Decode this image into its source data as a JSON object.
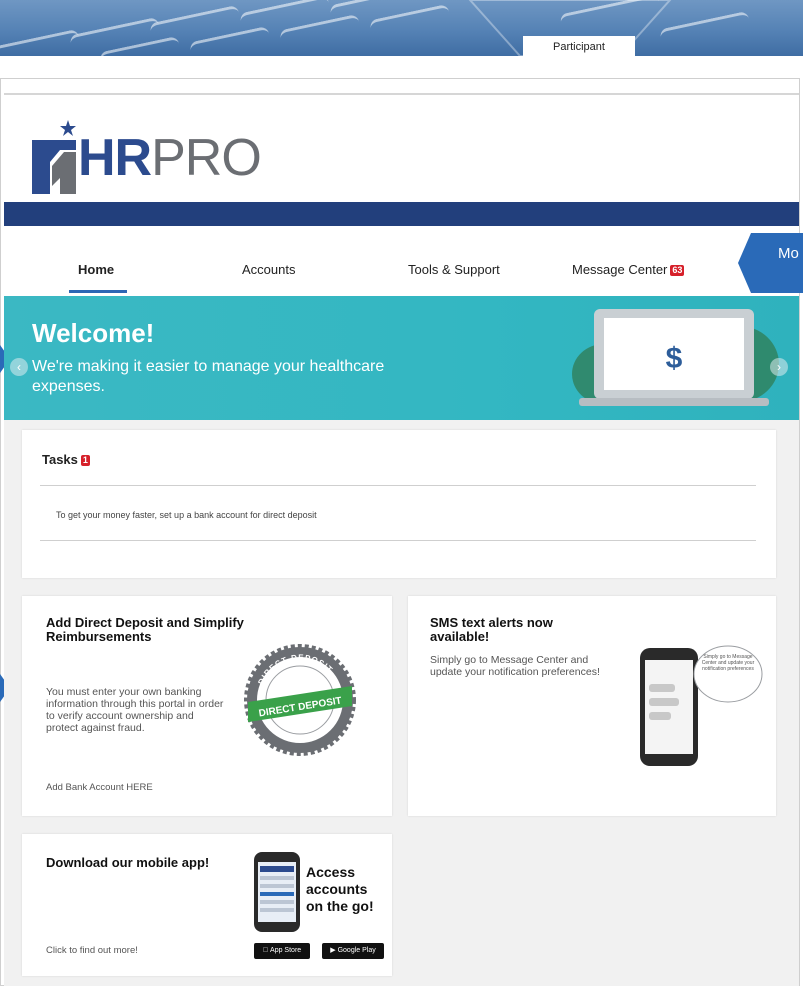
{
  "banner": {
    "tab_label": "Participant"
  },
  "logo": {
    "hr": "HR",
    "pro": "PRO"
  },
  "nav": {
    "home": "Home",
    "accounts": "Accounts",
    "tools": "Tools & Support",
    "message_center": "Message Center",
    "message_badge": "63"
  },
  "callout": {
    "text": "Mo fo"
  },
  "hero": {
    "title": "Welcome!",
    "subtitle": "We're making it easier to manage your healthcare expenses."
  },
  "tasks": {
    "title": "Tasks",
    "badge": "1",
    "item": "To get your money faster, set up a bank account for direct deposit"
  },
  "direct_deposit_card": {
    "title": "Add Direct Deposit and Simplify Reimbursements",
    "body": "You must enter your own banking information through this portal in order to verify account ownership and protect against fraud.",
    "link": "Add Bank Account HERE",
    "seal_ring": "DIRECT DEPOSIT",
    "seal_banner": "DIRECT DEPOSIT"
  },
  "sms_card": {
    "title": "SMS text alerts now available!",
    "body": "Simply go to Message Center and update your notification preferences!",
    "bubble": "Simply go to Message Center and update your notification preferences"
  },
  "mobile_card": {
    "title": "Download our mobile app!",
    "link": "Click to find out more!",
    "promo": "Access accounts on the go!",
    "app_store": "App Store",
    "google_play": "Google Play"
  },
  "hero_icon": "dollar-sign",
  "colors": {
    "navy": "#223f7c",
    "teal": "#33b7c2",
    "accent_blue": "#2a6ab8",
    "badge_red": "#d6202a",
    "seal_green": "#3aa14a"
  }
}
